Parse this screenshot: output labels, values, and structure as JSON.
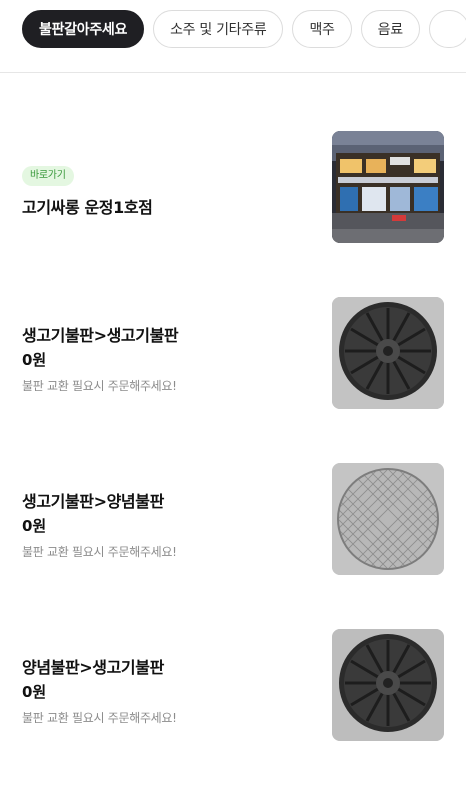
{
  "tabs": [
    {
      "label": "불판갈아주세요",
      "active": true
    },
    {
      "label": "소주 및 기타주류",
      "active": false
    },
    {
      "label": "맥주",
      "active": false
    },
    {
      "label": "음료",
      "active": false
    }
  ],
  "store": {
    "badge": "바로가기",
    "name": "고기싸롱 운정1호점",
    "image": "store-front-photo"
  },
  "items": [
    {
      "name": "생고기불판>생고기불판",
      "price": "0원",
      "description": "불판 교환 필요시 주문해주세요!",
      "image": "cast-iron-grill-plate-photo"
    },
    {
      "name": "생고기불판>양념불판",
      "price": "0원",
      "description": "불판 교환 필요시 주문해주세요!",
      "image": "wire-mesh-grill-photo"
    },
    {
      "name": "양념불판>생고기불판",
      "price": "0원",
      "description": "불판 교환 필요시 주문해주세요!",
      "image": "cast-iron-grill-plate-photo"
    }
  ]
}
